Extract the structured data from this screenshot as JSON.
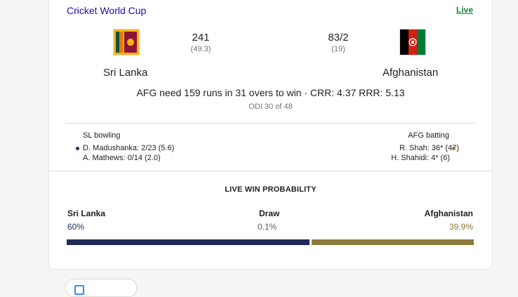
{
  "header": {
    "competition": "Cricket World Cup",
    "live_label": "Live"
  },
  "teams": {
    "home": {
      "name": "Sri Lanka",
      "score": "241",
      "overs": "(49.3)",
      "flag_icon": "sri-lanka-flag-icon"
    },
    "away": {
      "name": "Afghanistan",
      "score": "83/2",
      "overs": "(19)",
      "flag_icon": "afghanistan-flag-icon"
    }
  },
  "match": {
    "status": "AFG need 159 runs in 31 overs to win · CRR: 4.37 RRR: 5.13",
    "info": "ODI 30 of 48"
  },
  "bowling": {
    "title": "SL bowling",
    "lines": [
      "D. Madushanka: 2/23 (5.6)",
      "A. Mathews: 0/14 (2.0)"
    ]
  },
  "batting": {
    "title": "AFG batting",
    "lines": [
      "R. Shah: 36* (47)",
      "H. Shahidi: 4* (6)"
    ]
  },
  "win_probability": {
    "title": "LIVE WIN PROBABILITY",
    "home_label": "Sri Lanka",
    "home_value": "60%",
    "home_fraction": 0.6,
    "draw_label": "Draw",
    "draw_value": "0.1%",
    "draw_fraction": 0.001,
    "away_label": "Afghanistan",
    "away_value": "39.9%",
    "away_fraction": 0.399
  },
  "colors": {
    "home": "#1e2c5a",
    "away": "#8d7a3c",
    "link": "#1a0dab",
    "live": "#188038"
  }
}
